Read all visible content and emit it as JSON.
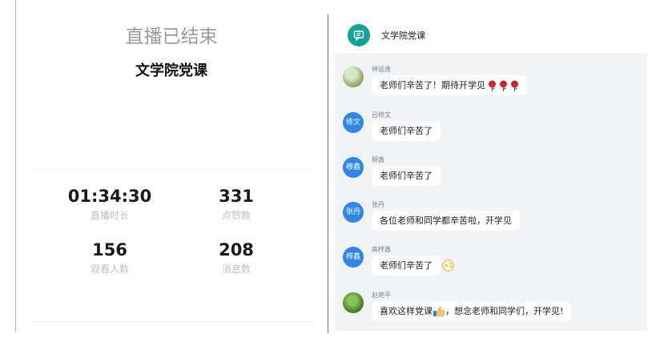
{
  "live_end": {
    "status": "直播已结束",
    "title": "文学院党课",
    "stats": [
      {
        "value": "01:34:30",
        "label": "直播时长"
      },
      {
        "value": "331",
        "label": "点赞数"
      },
      {
        "value": "156",
        "label": "观看人数"
      },
      {
        "value": "208",
        "label": "消息数"
      }
    ]
  },
  "chat": {
    "header_title": "文学院党课",
    "header_icon": "chat-bubble-icon",
    "accent": "#14a394",
    "messages": [
      {
        "sender": "钟运逸",
        "avatar_text": "",
        "text": "老师们辛苦了！期待开学见",
        "emoji": "rose x3"
      },
      {
        "sender": "吕修文",
        "avatar_text": "修文",
        "text": "老师们辛苦了"
      },
      {
        "sender": "穆鑫",
        "avatar_text": "穆鑫",
        "text": "老师们辛苦了"
      },
      {
        "sender": "张丹",
        "avatar_text": "张丹",
        "text": "各位老师和同学都辛苦啦，开学见"
      },
      {
        "sender": "高梓鑫",
        "avatar_text": "梓鑫",
        "text": "老师们辛苦了",
        "plus_one": "+1"
      },
      {
        "sender": "赵艳平",
        "avatar_text": "",
        "text_before": "喜欢这样党课",
        "text_after": "，想念老师和同学们，开学见!",
        "emoji": "thumbs-up"
      }
    ]
  }
}
